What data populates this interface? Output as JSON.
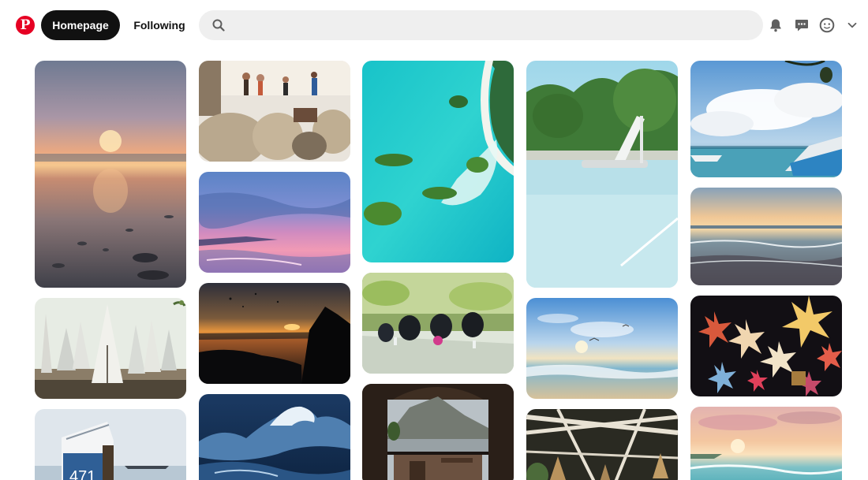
{
  "header": {
    "logo_icon": "pinterest-logo",
    "nav": {
      "home_label": "Homepage",
      "following_label": "Following"
    },
    "search": {
      "placeholder": "",
      "value": "",
      "icon": "search-icon"
    },
    "icons": [
      "bell-icon",
      "message-icon",
      "avatar-icon",
      "chevron-down-icon"
    ]
  },
  "colors": {
    "brand": "#e60023",
    "nav_active_bg": "#111111",
    "search_bg": "#efefef"
  },
  "feed": {
    "pins": [
      {
        "name": "pin-sunset-beach-pebbles",
        "column": 1
      },
      {
        "name": "pin-beach-umbrellas",
        "column": 1
      },
      {
        "name": "pin-beach-chair-471",
        "column": 1
      },
      {
        "name": "pin-beach-bean-bags",
        "column": 2
      },
      {
        "name": "pin-pink-sunset-sea",
        "column": 2
      },
      {
        "name": "pin-sunset-rocks-silhouette",
        "column": 2
      },
      {
        "name": "pin-ocean-wave",
        "column": 2
      },
      {
        "name": "pin-aerial-lagoon-islands",
        "column": 3
      },
      {
        "name": "pin-garden-restaurant",
        "column": 3
      },
      {
        "name": "pin-terrace-mountain-view",
        "column": 3
      },
      {
        "name": "pin-pool-slide",
        "column": 4
      },
      {
        "name": "pin-beach-sunrise-birds",
        "column": 4
      },
      {
        "name": "pin-pergola-lanterns",
        "column": 4
      },
      {
        "name": "pin-boat-blue-sky",
        "column": 5
      },
      {
        "name": "pin-sea-sunset-waves",
        "column": 5
      },
      {
        "name": "pin-star-lanterns",
        "column": 5
      },
      {
        "name": "pin-pastel-beach-sunset",
        "column": 5
      }
    ]
  }
}
